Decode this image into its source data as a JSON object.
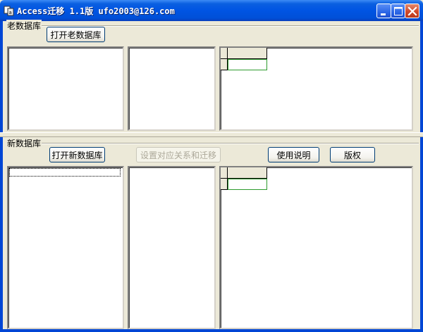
{
  "window": {
    "title": "Access迁移 1.1版 ufo2003@126.com"
  },
  "icons": {
    "app": "app-icon",
    "minimize": "minimize-icon",
    "maximize": "maximize-icon",
    "close": "close-icon"
  },
  "colors": {
    "titlebar": "#0054e3",
    "close_button": "#d2492a",
    "window_bg": "#ece9d8",
    "grid_selection": "#2e9b2e"
  },
  "old_db": {
    "group_label": "老数据库",
    "open_button": "打开老数据库"
  },
  "new_db": {
    "group_label": "新数据库",
    "open_button": "打开新数据库",
    "mapping_button": "设置对应关系和迁移",
    "help_button": "使用说明",
    "copyright_button": "版权"
  }
}
